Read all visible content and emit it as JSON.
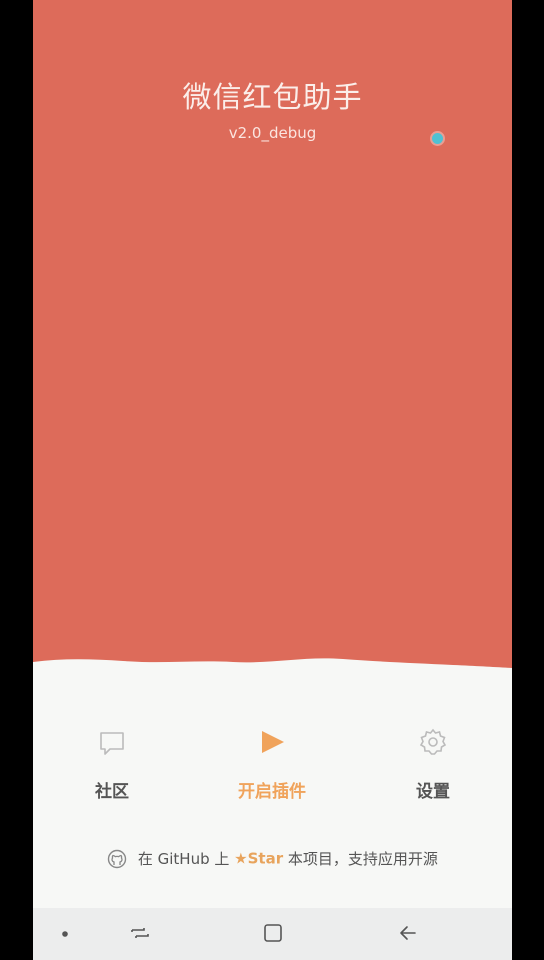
{
  "app": {
    "title": "微信红包助手",
    "version": "v2.0_debug"
  },
  "actions": [
    {
      "label": "社区",
      "icon": "chat-bubble-icon"
    },
    {
      "label": "开启插件",
      "icon": "play-icon"
    },
    {
      "label": "设置",
      "icon": "gear-icon"
    }
  ],
  "github": {
    "prefix": "在 GitHub 上",
    "star_label": "Star",
    "suffix": "本项目，支持应用开源",
    "icon": "github-icon"
  },
  "navbar": {
    "buttons": [
      "dot-icon",
      "recents-icon",
      "home-icon",
      "back-icon"
    ]
  },
  "colors": {
    "hero": "#dd6b5a",
    "accent": "#f0a35b",
    "background": "#f7f8f6"
  }
}
